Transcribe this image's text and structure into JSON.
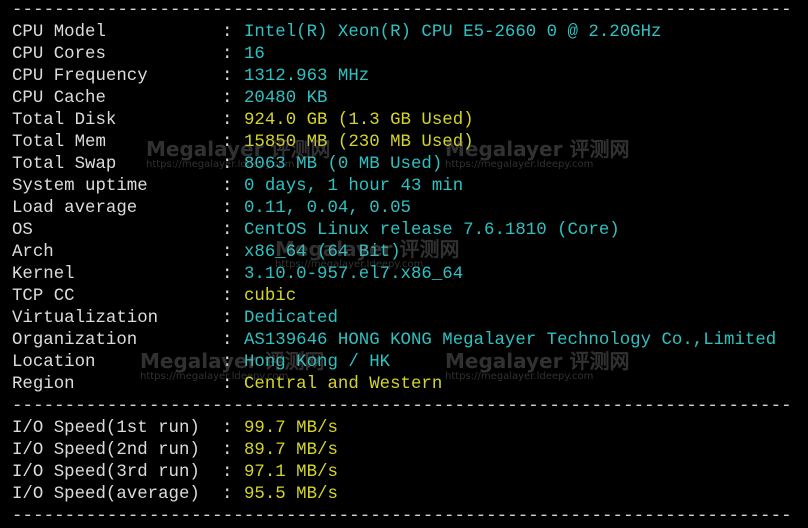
{
  "separator": "--------------------------------------------------------------------------",
  "info": [
    {
      "label": "CPU Model",
      "value": "Intel(R) Xeon(R) CPU E5-2660 0 @ 2.20GHz",
      "color": "cyan"
    },
    {
      "label": "CPU Cores",
      "value": "16",
      "color": "cyan"
    },
    {
      "label": "CPU Frequency",
      "value": "1312.963 MHz",
      "color": "cyan"
    },
    {
      "label": "CPU Cache",
      "value": "20480 KB",
      "color": "cyan"
    },
    {
      "label": "Total Disk",
      "value": "924.0 GB (1.3 GB Used)",
      "color": "yellow"
    },
    {
      "label": "Total Mem",
      "value": "15850 MB (230 MB Used)",
      "color": "yellow"
    },
    {
      "label": "Total Swap",
      "value": "8063 MB (0 MB Used)",
      "color": "cyan"
    },
    {
      "label": "System uptime",
      "value": "0 days, 1 hour 43 min",
      "color": "cyan"
    },
    {
      "label": "Load average",
      "value": "0.11, 0.04, 0.05",
      "color": "cyan"
    },
    {
      "label": "OS",
      "value": "CentOS Linux release 7.6.1810 (Core)",
      "color": "cyan"
    },
    {
      "label": "Arch",
      "value": "x86_64 (64 Bit)",
      "color": "cyan"
    },
    {
      "label": "Kernel",
      "value": "3.10.0-957.el7.x86_64",
      "color": "cyan"
    },
    {
      "label": "TCP CC",
      "value": "cubic",
      "color": "yellow"
    },
    {
      "label": "Virtualization",
      "value": "Dedicated",
      "color": "cyan"
    },
    {
      "label": "Organization",
      "value": "AS139646 HONG KONG Megalayer Technology Co.,Limited",
      "color": "cyan"
    },
    {
      "label": "Location",
      "value": "Hong Kong / HK",
      "color": "cyan"
    },
    {
      "label": "Region",
      "value": "Central and Western",
      "color": "yellow"
    }
  ],
  "io": [
    {
      "label": "I/O Speed(1st run)",
      "value": "99.7 MB/s",
      "color": "yellow"
    },
    {
      "label": "I/O Speed(2nd run)",
      "value": "89.7 MB/s",
      "color": "yellow"
    },
    {
      "label": "I/O Speed(3rd run)",
      "value": "97.1 MB/s",
      "color": "yellow"
    },
    {
      "label": "I/O Speed(average)",
      "value": "95.5 MB/s",
      "color": "yellow"
    }
  ],
  "colon": ":",
  "watermark": {
    "brand": "Megalayer 评测网",
    "url": "https://megalayer.ldeepy.com"
  },
  "colors": {
    "background": "#000000",
    "label": "#dcdcdc",
    "cyan": "#2fc1c1",
    "yellow": "#d4d42a"
  }
}
